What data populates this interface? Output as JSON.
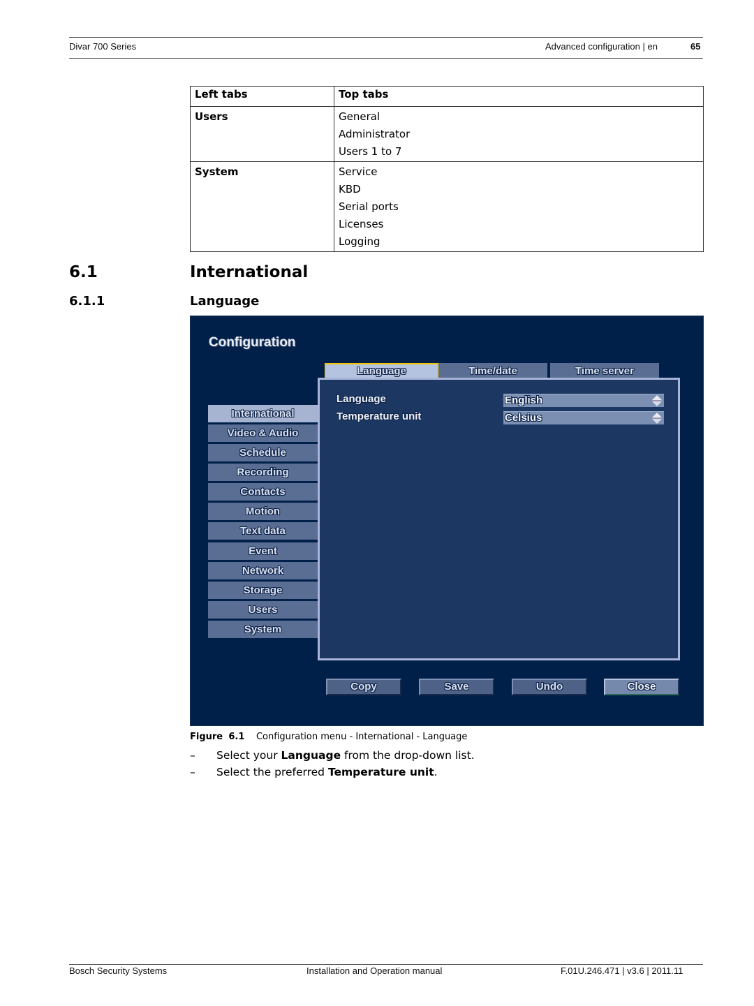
{
  "header": {
    "product": "Divar 700 Series",
    "section": "Advanced configuration | en",
    "page_number": "65"
  },
  "table": {
    "headers": [
      "Left tabs",
      "Top tabs"
    ],
    "rows": [
      {
        "left": "Users",
        "top": [
          "General",
          "Administrator",
          "Users 1 to 7"
        ]
      },
      {
        "left": "System",
        "top": [
          "Service",
          "KBD",
          "Serial ports",
          "Licenses",
          "Logging"
        ]
      }
    ]
  },
  "section": {
    "number": "6.1",
    "title": "International"
  },
  "subsection": {
    "number": "6.1.1",
    "title": "Language"
  },
  "config_ui": {
    "title": "Configuration",
    "top_tabs": [
      {
        "label": "Language",
        "active": true
      },
      {
        "label": "Time/date",
        "active": false
      },
      {
        "label": "Time server",
        "active": false
      }
    ],
    "side_tabs": [
      {
        "label": "International",
        "active": true
      },
      {
        "label": "Video & Audio",
        "active": false
      },
      {
        "label": "Schedule",
        "active": false
      },
      {
        "label": "Recording",
        "active": false
      },
      {
        "label": "Contacts",
        "active": false
      },
      {
        "label": "Motion",
        "active": false
      },
      {
        "label": "Text data",
        "active": false
      },
      {
        "label": "Event",
        "active": false
      },
      {
        "label": "Network",
        "active": false
      },
      {
        "label": "Storage",
        "active": false
      },
      {
        "label": "Users",
        "active": false
      },
      {
        "label": "System",
        "active": false
      }
    ],
    "fields": [
      {
        "label": "Language",
        "value": "English",
        "icon": "updown-arrow-icon"
      },
      {
        "label": "Temperature unit",
        "value": "Celsius",
        "icon": "updown-arrow-icon"
      }
    ],
    "buttons": {
      "copy": "Copy",
      "save": "Save",
      "undo": "Undo",
      "close": "Close"
    },
    "colors": {
      "background": "#002049",
      "panel": "#1c3862",
      "tab": "#5a6d92",
      "tab_active": "#b4c3df",
      "focus_border": "#f2c300"
    }
  },
  "figure": {
    "label": "Figure",
    "number": "6.1",
    "caption": "Configuration menu - International - Language"
  },
  "instructions": [
    {
      "dash": "–",
      "before": "Select your ",
      "bold": "Language",
      "after": " from the drop-down list."
    },
    {
      "dash": "–",
      "before": "Select the preferred ",
      "bold": "Temperature unit",
      "after": "."
    }
  ],
  "footer": {
    "company": "Bosch Security Systems",
    "doc_title": "Installation and Operation manual",
    "doc_id": "F.01U.246.471 | v3.6 | 2011.11"
  }
}
